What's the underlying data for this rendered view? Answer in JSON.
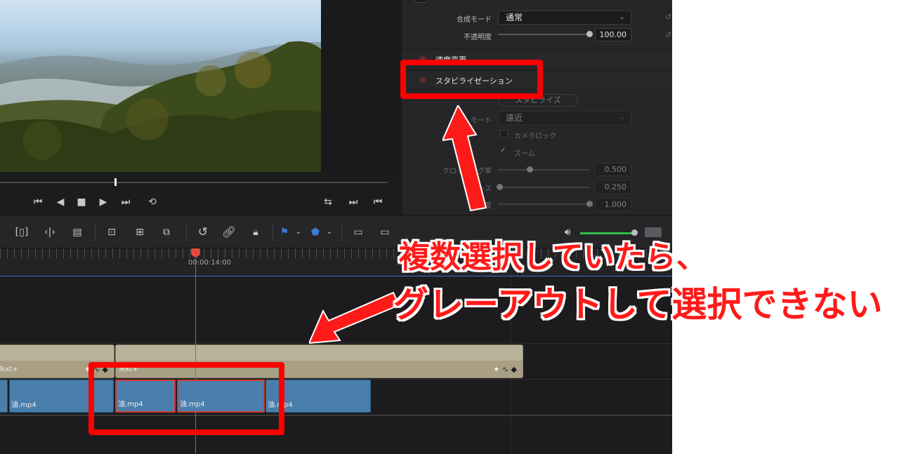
{
  "inspector": {
    "composite_mode_label": "合成モード",
    "composite_mode_value": "通常",
    "opacity_label": "不透明度",
    "opacity_value": "100.00",
    "speed_change_title": "速度変更",
    "stabilization_title": "スタビライゼーション",
    "stabilize_button": "スタビライズ",
    "mode_label": "モード",
    "mode_value": "遠近",
    "camera_lock_label": "カメラロック",
    "zoom_label": "ズーム",
    "cropping_ratio_label": "クロッピング率",
    "cropping_ratio_value": "0.500",
    "smooth_label": "スムース",
    "smooth_value": "0.250",
    "strength_label": "強度",
    "strength_value": "1.000"
  },
  "timeline": {
    "timecode": "00:00:14:00",
    "text_clip_label": "Text+",
    "video_clip_label": "油.mp4"
  },
  "annotation": {
    "line1": "複数選択していたら、",
    "line2": "グレーアウトして選択できない"
  },
  "colors": {
    "annotation_red": "#ff0000",
    "clip_blue": "#497eaa",
    "text_clip": "#b9b29b",
    "playhead": "#e14a3c"
  }
}
